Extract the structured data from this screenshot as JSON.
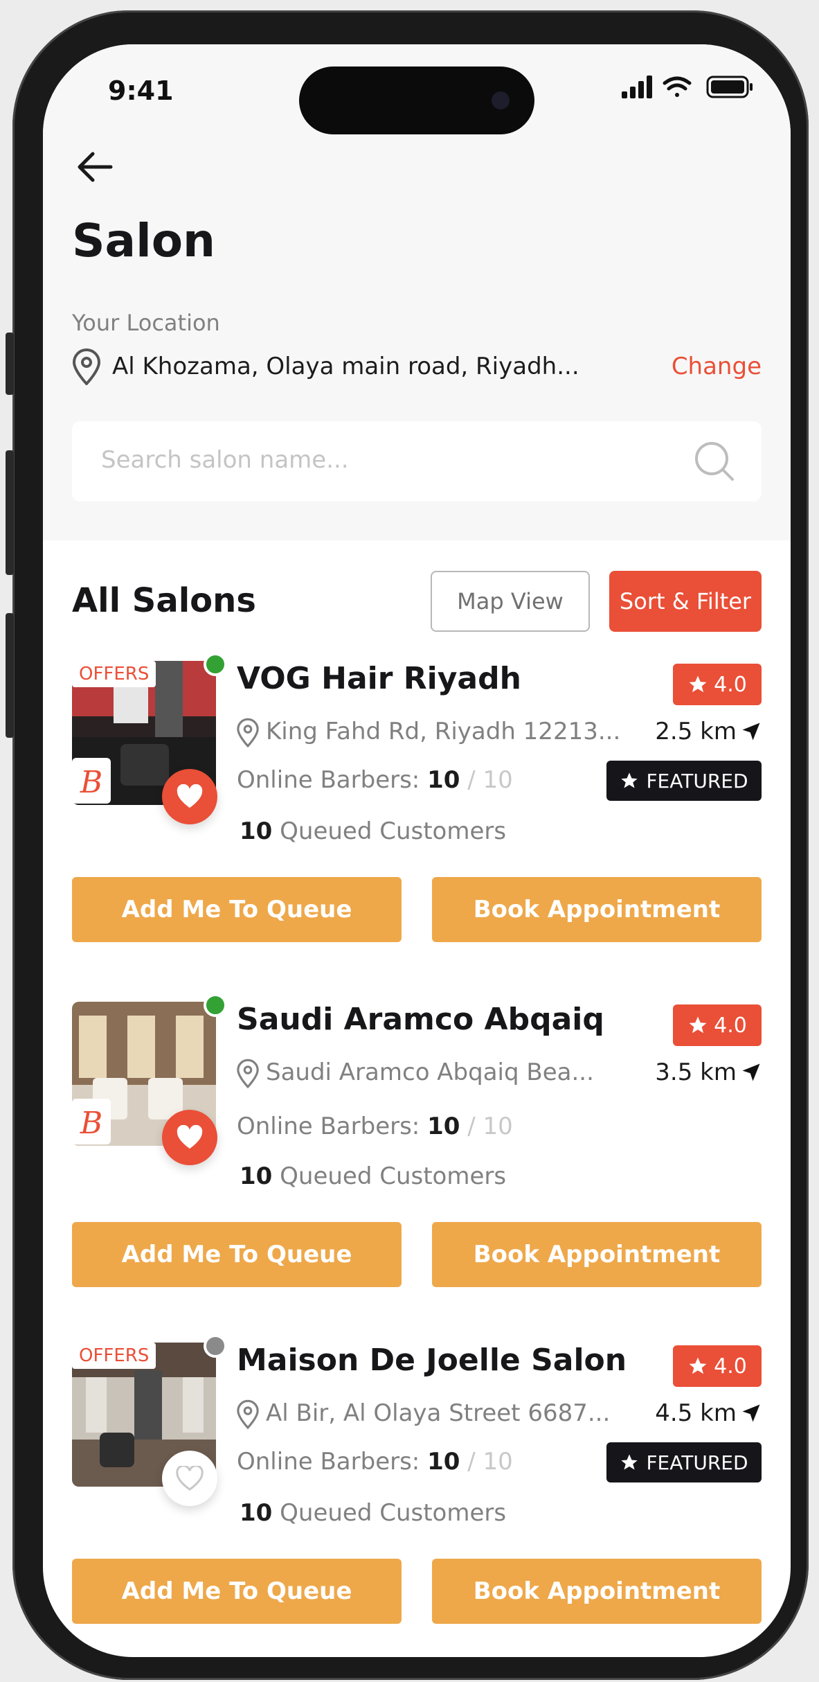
{
  "status_bar": {
    "time": "9:41"
  },
  "header": {
    "title": "Salon"
  },
  "location": {
    "label": "Your Location",
    "value": "Al Khozama, Olaya main road, Riyadh...",
    "change_label": "Change"
  },
  "search": {
    "placeholder": "Search salon name..."
  },
  "section": {
    "title": "All Salons",
    "map_view_label": "Map View",
    "sort_filter_label": "Sort & Filter"
  },
  "colors": {
    "accent": "#ea4f37",
    "action": "#eea84a",
    "online": "#33a133",
    "offline": "#8a8a8a",
    "featured_bg": "#15151a"
  },
  "salons": [
    {
      "name": "VOG Hair Riyadh",
      "address": "King Fahd Rd, Riyadh 12213...",
      "rating": "4.0",
      "distance": "2.5 km",
      "offers_label": "OFFERS",
      "featured_label": "FEATURED",
      "online_barbers_label": "Online Barbers:",
      "online_barbers": "10",
      "total_barbers": "10",
      "queued_count": "10",
      "queued_label": "Queued Customers",
      "online": true,
      "favorite": true,
      "queue_button": "Add Me To Queue",
      "book_button": "Book Appointment"
    },
    {
      "name": "Saudi Aramco Abqaiq",
      "address": "Saudi Aramco Abqaiq Bea...",
      "rating": "4.0",
      "distance": "3.5 km",
      "online_barbers_label": "Online Barbers:",
      "online_barbers": "10",
      "total_barbers": "10",
      "queued_count": "10",
      "queued_label": "Queued Customers",
      "online": true,
      "favorite": true,
      "queue_button": "Add Me To Queue",
      "book_button": "Book Appointment"
    },
    {
      "name": "Maison De Joelle Salon",
      "address": "Al Bir, Al Olaya Street 6687...",
      "rating": "4.0",
      "distance": "4.5 km",
      "offers_label": "OFFERS",
      "featured_label": "FEATURED",
      "online_barbers_label": "Online Barbers:",
      "online_barbers": "10",
      "total_barbers": "10",
      "queued_count": "10",
      "queued_label": "Queued Customers",
      "online": false,
      "favorite": false,
      "queue_button": "Add Me To Queue",
      "book_button": "Book Appointment"
    }
  ]
}
